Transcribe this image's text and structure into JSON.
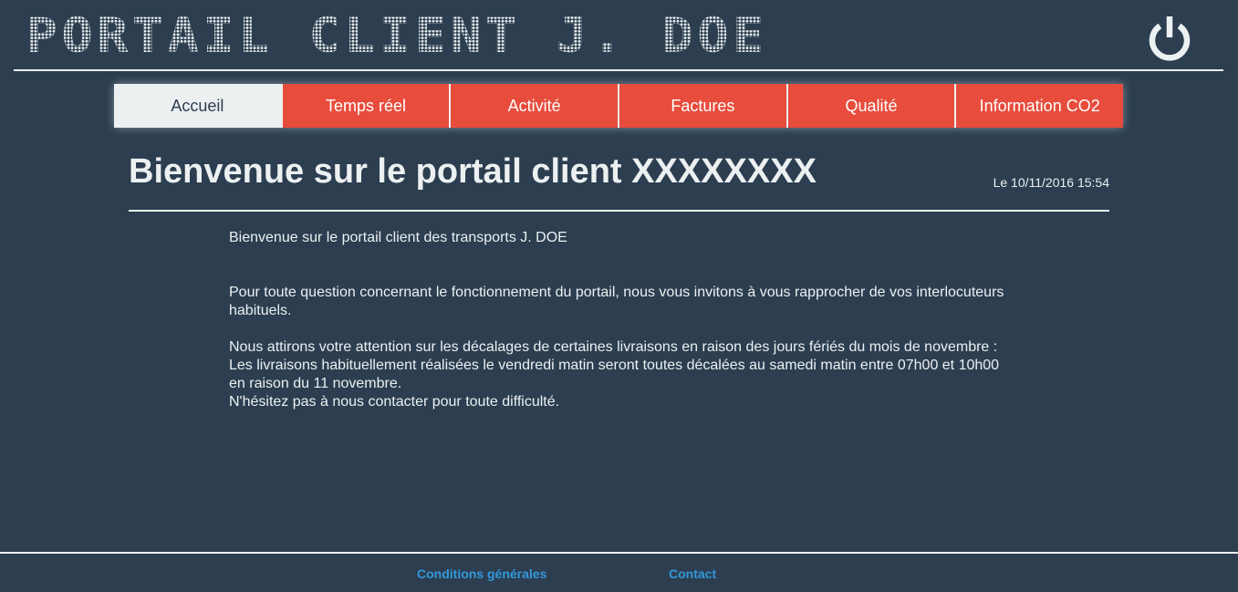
{
  "header": {
    "logo_text": "PORTAIL CLIENT J. DOE",
    "power_icon": "power-icon"
  },
  "nav": {
    "tabs": [
      {
        "label": "Accueil",
        "active": true
      },
      {
        "label": "Temps réel",
        "active": false
      },
      {
        "label": "Activité",
        "active": false
      },
      {
        "label": "Factures",
        "active": false
      },
      {
        "label": "Qualité",
        "active": false
      },
      {
        "label": "Information CO2",
        "active": false
      }
    ]
  },
  "main": {
    "title": "Bienvenue sur le portail client XXXXXXXX",
    "datetime": "Le 10/11/2016 15:54",
    "paragraphs": [
      "Bienvenue sur le portail client des transports J. DOE",
      "Pour toute question concernant le fonctionnement du portail, nous vous invitons à vous rapprocher de vos interlocuteurs habituels.",
      "Nous attirons votre attention sur les décalages de certaines livraisons en raison des jours fériés du mois de novembre :",
      "Les livraisons habituellement réalisées le vendredi matin seront toutes décalées au samedi matin entre 07h00 et 10h00 en raison du 11 novembre.",
      "N'hésitez pas à nous contacter pour toute difficulté."
    ]
  },
  "footer": {
    "links": [
      "Conditions générales",
      "Contact"
    ]
  },
  "colors": {
    "background": "#2c3e50",
    "nav_tab": "#e74c3c",
    "nav_active": "#ecf0f1",
    "footer_link": "#3498db"
  }
}
